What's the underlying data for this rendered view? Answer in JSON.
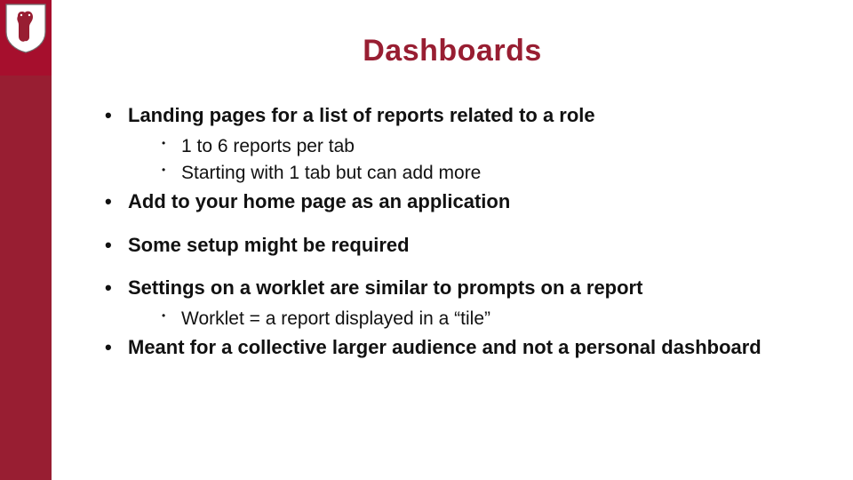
{
  "title": "Dashboards",
  "colors": {
    "crimson_light": "#a60f2d",
    "crimson": "#981e32"
  },
  "bullets": {
    "b1": {
      "text": "Landing pages for a list of reports related to a role",
      "sub": [
        "1 to 6 reports per tab",
        "Starting with 1 tab but can add more"
      ]
    },
    "b2": {
      "text": "Add to your home page as an application"
    },
    "b3": {
      "text": "Some setup might be required"
    },
    "b4": {
      "text": "Settings on a worklet are similar to prompts on a report",
      "sub": [
        "Worklet = a report displayed in a “tile”"
      ]
    },
    "b5": {
      "text": "Meant for a collective larger audience and not a personal dashboard"
    }
  }
}
